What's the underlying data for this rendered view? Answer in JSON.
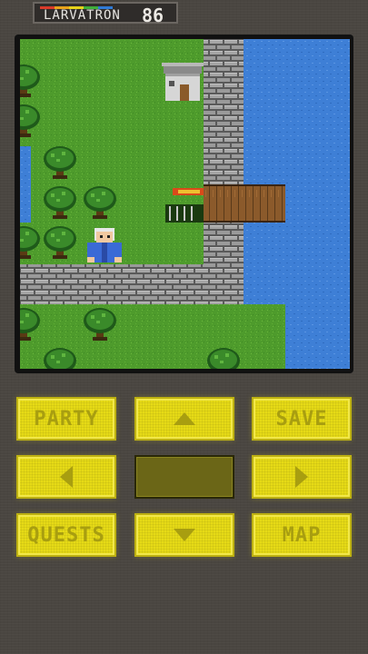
{
  "app": {
    "brand_text": "LARVATRON",
    "brand_number": "86"
  },
  "controls": {
    "party_label": "PARTY",
    "save_label": "SAVE",
    "quests_label": "QUESTS",
    "map_label": "MAP"
  },
  "icons": {
    "up": "arrow-up-icon",
    "down": "arrow-down-icon",
    "left": "arrow-left-icon",
    "right": "arrow-right-icon"
  },
  "colors": {
    "grass": "#4e9b2c",
    "water": "#3e7fd6",
    "stone": "#9a9a9a",
    "button": "#e6da16",
    "button_text": "#a89e10"
  }
}
